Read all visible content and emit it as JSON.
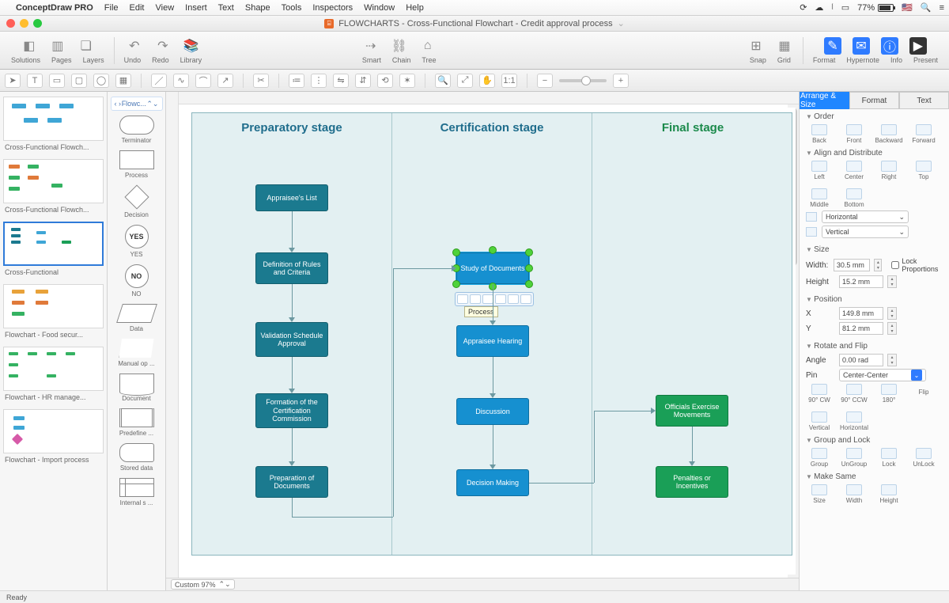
{
  "menubar": {
    "app": "ConceptDraw PRO",
    "items": [
      "File",
      "Edit",
      "View",
      "Insert",
      "Text",
      "Shape",
      "Tools",
      "Inspectors",
      "Window",
      "Help"
    ],
    "battery": "77%"
  },
  "title": {
    "doc": "FLOWCHARTS - Cross-Functional Flowchart - Credit approval process"
  },
  "toolbar": {
    "solutions": "Solutions",
    "pages": "Pages",
    "layers": "Layers",
    "undo": "Undo",
    "redo": "Redo",
    "library": "Library",
    "smart": "Smart",
    "chain": "Chain",
    "tree": "Tree",
    "snap": "Snap",
    "grid": "Grid",
    "format": "Format",
    "hypernote": "Hypernote",
    "info": "Info",
    "present": "Present"
  },
  "shape_crumb": "Flowc...",
  "shapes": [
    {
      "k": "terminator",
      "l": "Terminator"
    },
    {
      "k": "process",
      "l": "Process"
    },
    {
      "k": "decision",
      "l": "Decision"
    },
    {
      "k": "yes",
      "l": "YES",
      "txt": "YES"
    },
    {
      "k": "no",
      "l": "NO",
      "txt": "NO"
    },
    {
      "k": "data",
      "l": "Data"
    },
    {
      "k": "manual",
      "l": "Manual op ..."
    },
    {
      "k": "document",
      "l": "Document"
    },
    {
      "k": "predef",
      "l": "Predefine ..."
    },
    {
      "k": "stored",
      "l": "Stored data"
    },
    {
      "k": "internal",
      "l": "Internal s ..."
    }
  ],
  "thumbs": [
    {
      "l": "Cross-Functional Flowch...",
      "sel": false
    },
    {
      "l": "Cross-Functional Flowch...",
      "sel": false
    },
    {
      "l": "Cross-Functional",
      "sel": true
    },
    {
      "l": "Flowchart - Food secur...",
      "sel": false
    },
    {
      "l": "Flowchart - HR manage...",
      "sel": false
    },
    {
      "l": "Flowchart - Import process",
      "sel": false
    }
  ],
  "swim": {
    "col1": "Preparatory stage",
    "col2": "Certification stage",
    "col3": "Final stage",
    "boxes": {
      "a1": "Appraisee's List",
      "a2": "Definition of Rules and Criteria",
      "a3": "Validation Schedule Approval",
      "a4": "Formation of the Certification Commission",
      "a5": "Preparation of Documents",
      "b1": "Study of Documents",
      "b2": "Appraisee Hearing",
      "b3": "Discussion",
      "b4": "Decision Making",
      "c1": "Officials Exercise Movements",
      "c2": "Penalties or Incentives"
    },
    "tooltip": "Process"
  },
  "inspector": {
    "tabs": [
      "Arrange & Size",
      "Format",
      "Text"
    ],
    "order": {
      "t": "Order",
      "back": "Back",
      "front": "Front",
      "backward": "Backward",
      "forward": "Forward"
    },
    "align": {
      "t": "Align and Distribute",
      "left": "Left",
      "center": "Center",
      "right": "Right",
      "top": "Top",
      "middle": "Middle",
      "bottom": "Bottom",
      "horiz": "Horizontal",
      "vert": "Vertical"
    },
    "size": {
      "t": "Size",
      "wl": "Width:",
      "w": "30.5 mm",
      "hl": "Height",
      "h": "15.2 mm",
      "lock": "Lock Proportions"
    },
    "pos": {
      "t": "Position",
      "xl": "X",
      "x": "149.8 mm",
      "yl": "Y",
      "y": "81.2 mm"
    },
    "rot": {
      "t": "Rotate and Flip",
      "al": "Angle",
      "a": "0.00 rad",
      "pl": "Pin",
      "p": "Center-Center",
      "cw": "90° CW",
      "ccw": "90° CCW",
      "r180": "180°",
      "flip": "Flip",
      "fv": "Vertical",
      "fh": "Horizontal"
    },
    "group": {
      "t": "Group and Lock",
      "g": "Group",
      "ug": "UnGroup",
      "lk": "Lock",
      "ulk": "UnLock"
    },
    "same": {
      "t": "Make Same",
      "sz": "Size",
      "w": "Width",
      "h": "Height"
    }
  },
  "zoom": "Custom 97%",
  "status": "Ready"
}
